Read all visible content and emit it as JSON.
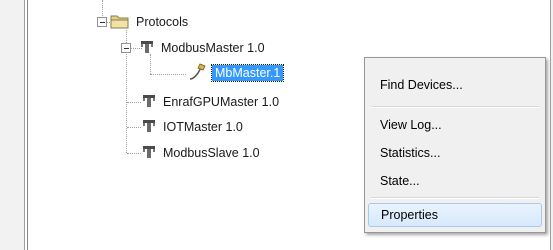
{
  "tree": {
    "protocols": {
      "label": "Protocols",
      "icon": "folder-icon"
    },
    "modbus_master": {
      "label": "ModbusMaster 1.0",
      "icon": "protocol-plug-icon"
    },
    "mb_master_1": {
      "label": "MbMaster.1",
      "icon": "channel-plug-icon",
      "selected": true
    },
    "enraf_gpu_master": {
      "label": "EnrafGPUMaster 1.0",
      "icon": "protocol-plug-icon"
    },
    "iot_master": {
      "label": "IOTMaster 1.0",
      "icon": "protocol-plug-icon"
    },
    "modbus_slave": {
      "label": "ModbusSlave 1.0",
      "icon": "protocol-plug-icon"
    }
  },
  "context_menu": {
    "items": [
      {
        "label": "Find Devices..."
      },
      {
        "label": "View Log..."
      },
      {
        "label": "Statistics..."
      },
      {
        "label": "State..."
      },
      {
        "label": "Properties",
        "highlighted": true
      }
    ]
  },
  "colors": {
    "selection": "#3399ff",
    "menu_bg": "#f0f0f0",
    "menu_highlight": "#dcebfc"
  }
}
